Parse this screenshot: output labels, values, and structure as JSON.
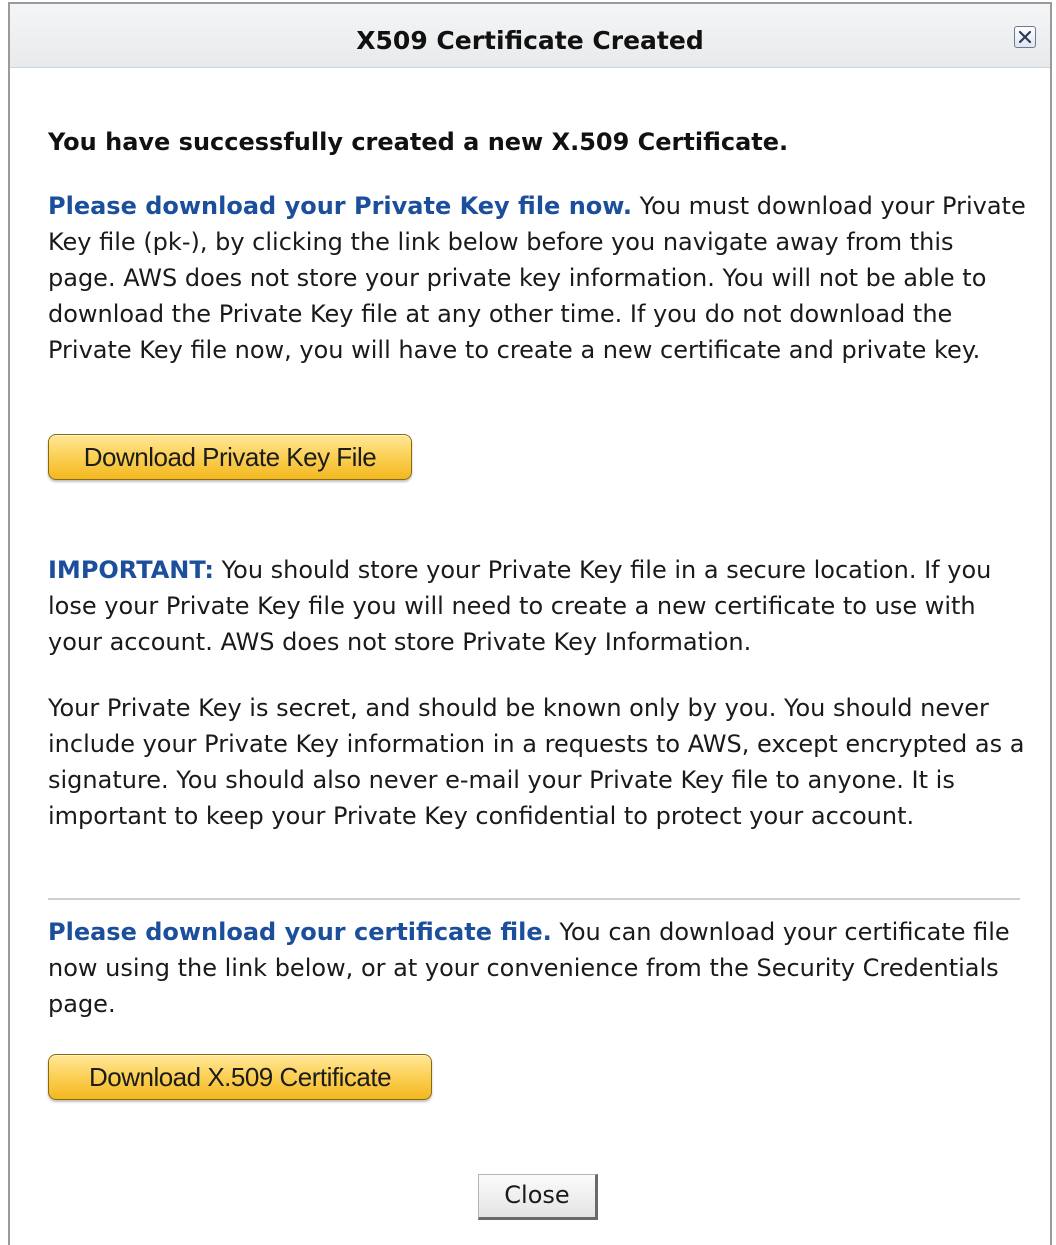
{
  "dialog": {
    "title": "X509 Certificate Created",
    "close_icon": "close-icon"
  },
  "content": {
    "headline": "You have successfully created a new X.509 Certificate.",
    "private_key_section": {
      "lead": "Please download your Private Key file now.",
      "body": " You must download your Private Key file (pk-), by clicking the link below before you navigate away from this page. AWS does not store your private key information. You will not be able to download the Private Key file at any other time. If you do not download the Private Key file now, you will have to create a new certificate and private key."
    },
    "download_private_key_label": "Download Private Key File",
    "important_section": {
      "lead": "IMPORTANT:",
      "body": " You should store your Private Key file in a secure location. If you lose your Private Key file you will need to create a new certificate to use with your account. AWS does not store Private Key Information."
    },
    "secret_paragraph": "Your Private Key is secret, and should be known only by you. You should never include your Private Key information in a requests to AWS, except encrypted as a signature. You should also never e-mail your Private Key file to anyone. It is important to keep your Private Key confidential to protect your account.",
    "certificate_section": {
      "lead": "Please download your certificate file.",
      "body": " You can download your certificate file now using the link below, or at your convenience from the Security Credentials page."
    },
    "download_certificate_label": "Download X.509 Certificate",
    "close_label": "Close"
  },
  "colors": {
    "lead_text": "#1b4f9c",
    "button_gold": "#fcd25a",
    "title_bar": "#eceef0"
  }
}
